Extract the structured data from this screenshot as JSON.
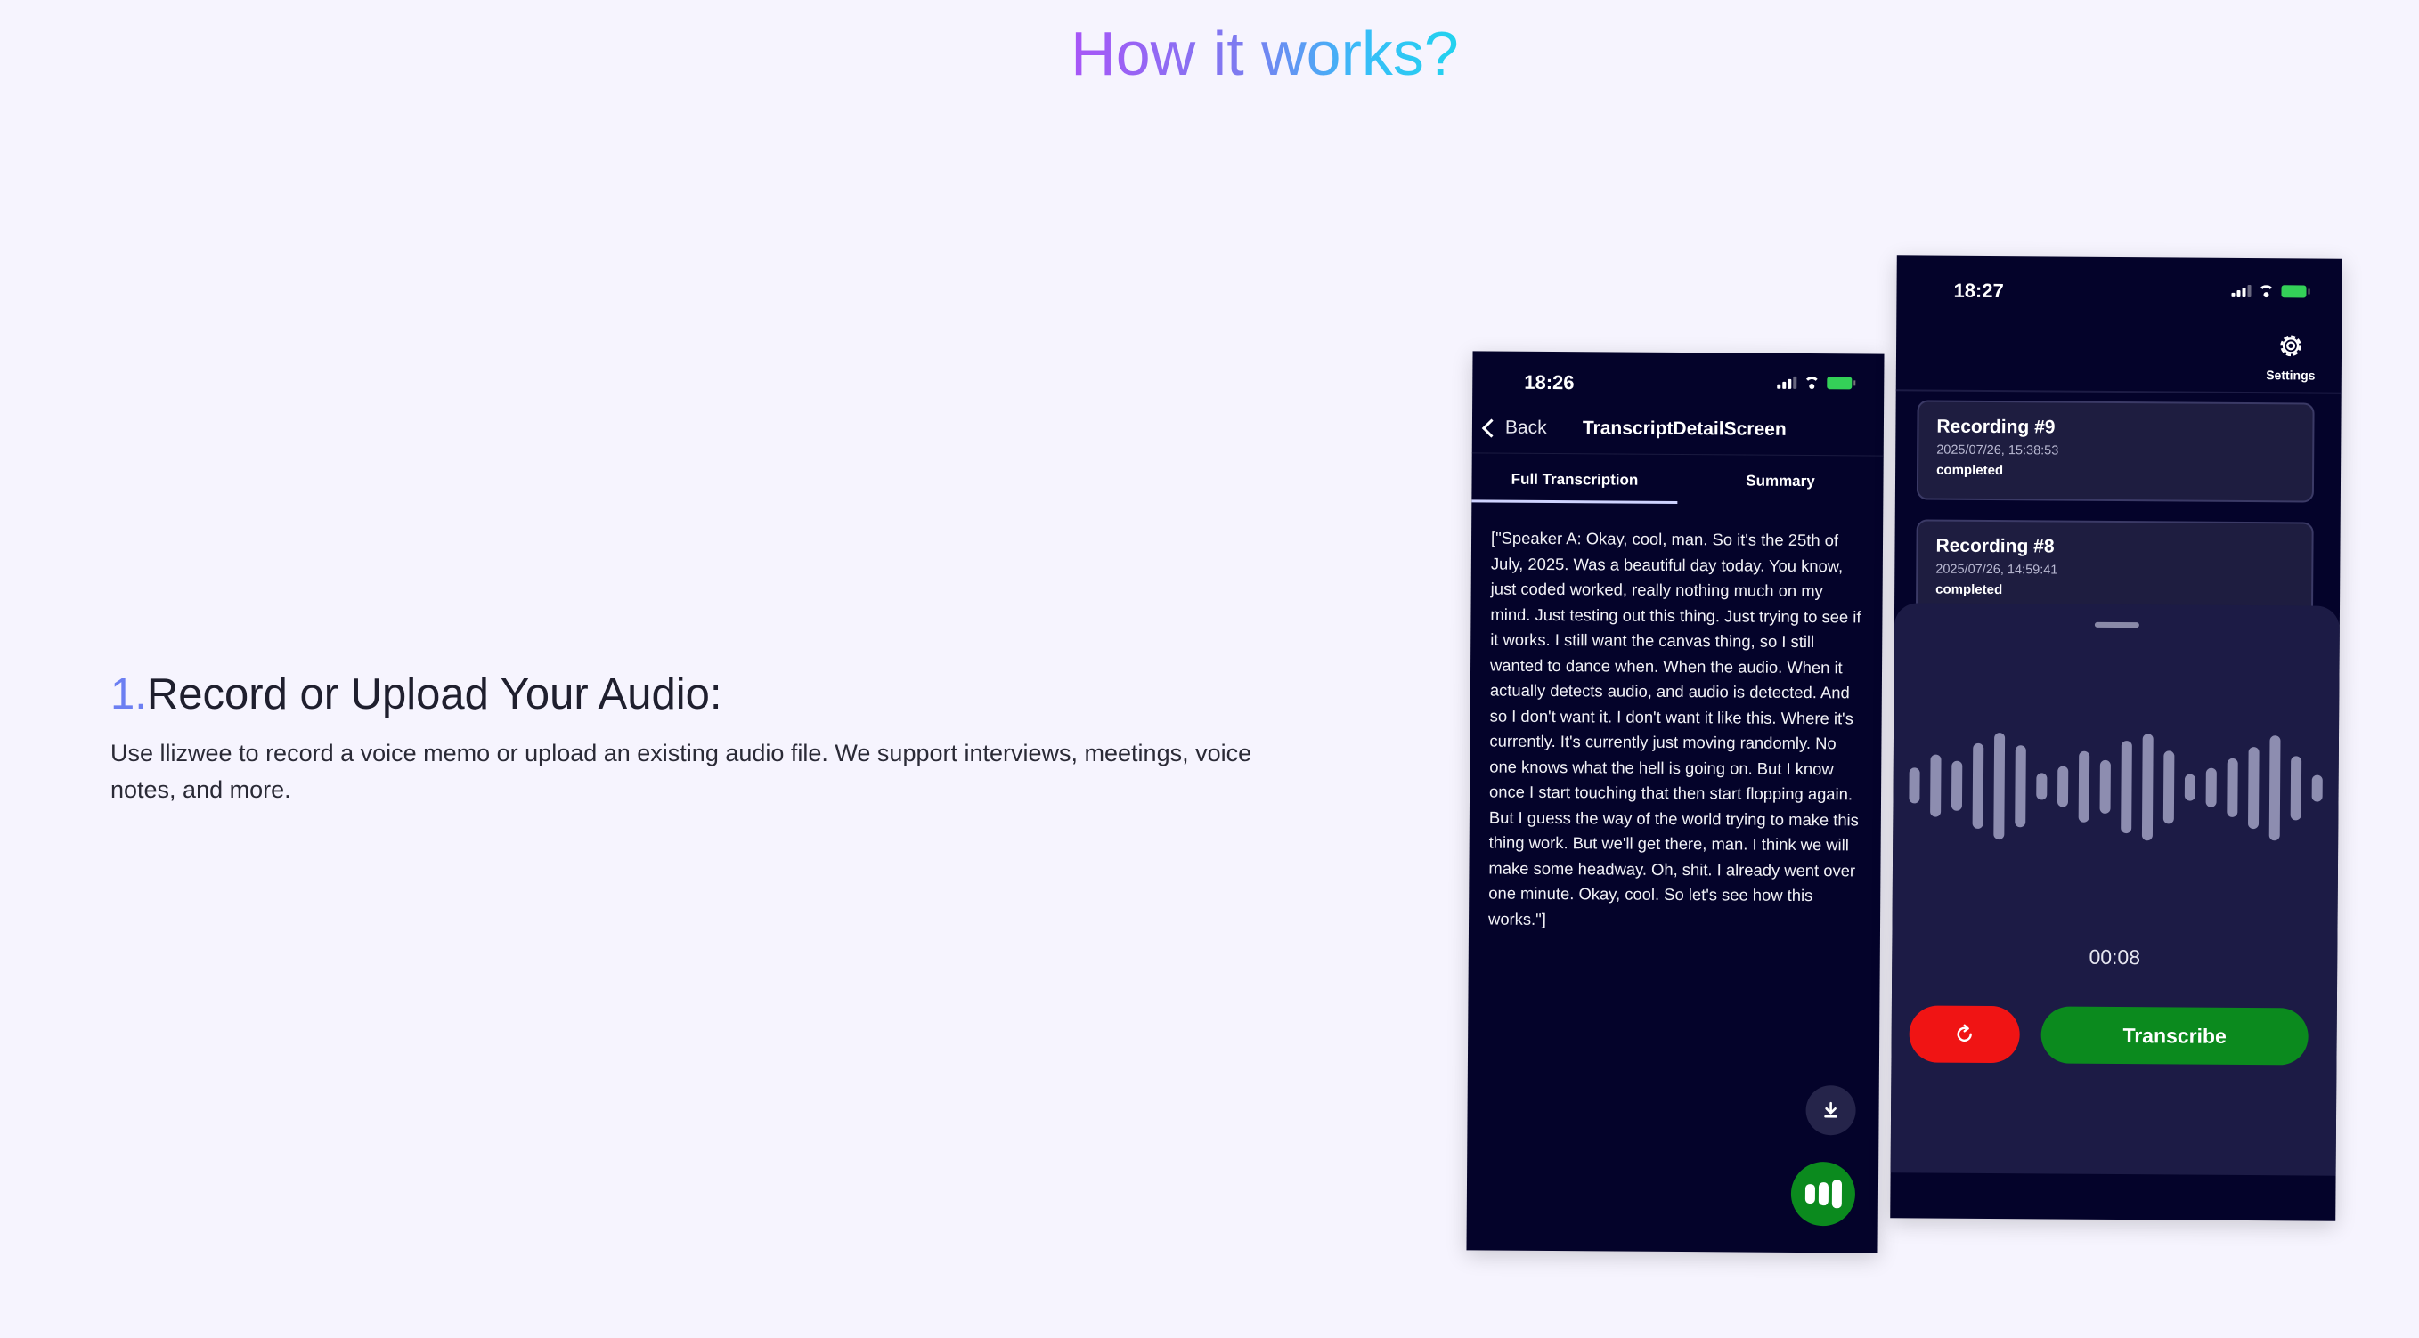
{
  "page": {
    "title": "How it works?"
  },
  "step": {
    "number": "1.",
    "heading": "Record or Upload Your Audio:",
    "description": "Use llizwee to record a voice memo or upload an existing audio file. We support interviews, meetings, voice notes, and more."
  },
  "phone1": {
    "time": "18:26",
    "back_label": "Back",
    "screen_title": "TranscriptDetailScreen",
    "tabs": [
      {
        "label": "Full Transcription",
        "active": true
      },
      {
        "label": "Summary",
        "active": false
      }
    ],
    "transcript": "[\"Speaker A: Okay, cool, man. So it's the 25th of July, 2025. Was a beautiful day today. You know, just coded worked, really nothing much on my mind. Just testing out this thing. Just trying to see if it works. I still want the canvas thing, so I still wanted to dance when. When the audio. When it actually detects audio, and audio is detected. And so I don't want it. I don't want it like this. Where it's currently. It's currently just moving randomly. No one knows what the hell is going on. But I know once I start touching that then start flopping again. But I guess the way of the world trying to make this thing work. But we'll get there, man. I think we will make some headway. Oh, shit. I already went over one minute. Okay, cool. So let's see how this works.\"]",
    "icons": {
      "download": "download-icon",
      "mic": "audio-bars-icon"
    },
    "accent": "#0b8a1e"
  },
  "phone2": {
    "time": "18:27",
    "settings_label": "Settings",
    "recordings": [
      {
        "title": "Recording #9",
        "date": "2025/07/26, 15:38:53",
        "status": "completed"
      },
      {
        "title": "Recording #8",
        "date": "2025/07/26, 14:59:41",
        "status": "completed"
      }
    ],
    "timer": "00:08",
    "transcribe_label": "Transcribe",
    "colors": {
      "reset": "#f01414",
      "transcribe": "#0b8a1e"
    }
  }
}
